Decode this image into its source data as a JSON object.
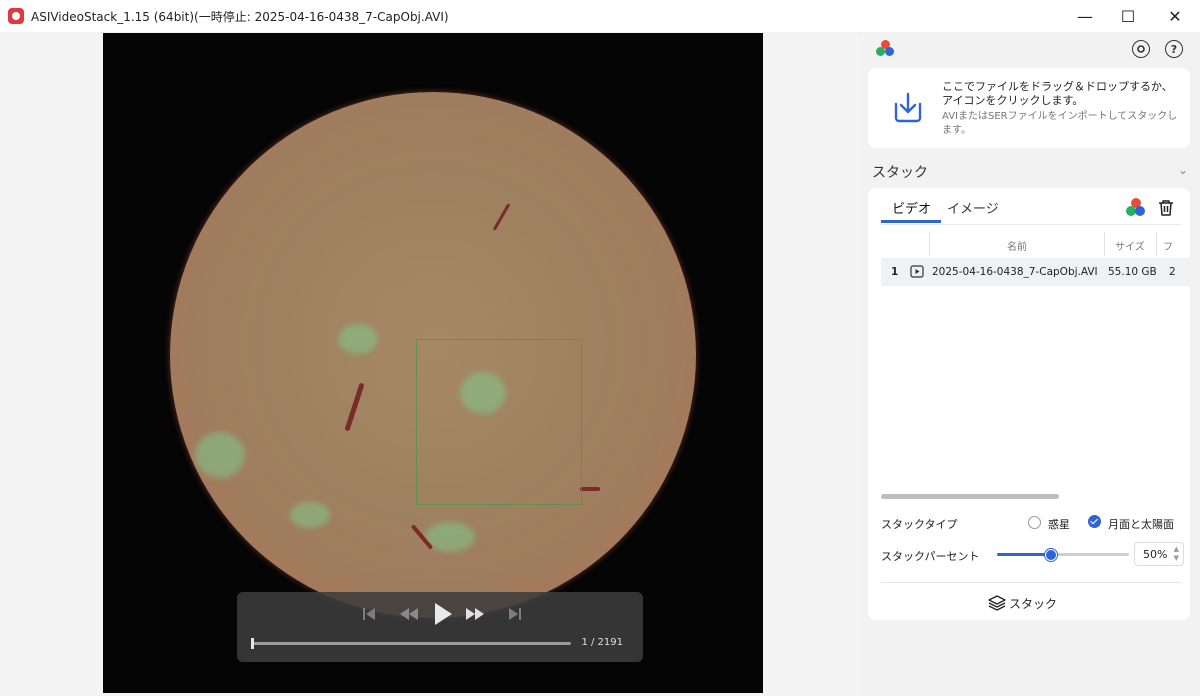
{
  "window": {
    "title": "ASIVideoStack_1.15 (64bit)(一時停止: 2025-04-16-0438_7-CapObj.AVI)",
    "controls": {
      "minimize": "—",
      "maximize": "☐",
      "close": "✕"
    }
  },
  "player": {
    "frame_counter": "1 / 2191",
    "progress": 0.0,
    "icons": [
      "skip-back-icon",
      "rewind-icon",
      "play-icon",
      "fast-forward-icon",
      "skip-forward-icon"
    ]
  },
  "panel": {
    "import": {
      "main_text": "ここでファイルをドラッグ＆ドロップするか、アイコンをクリックします。",
      "sub_text": "AVIまたはSERファイルをインポートしてスタックします。"
    },
    "stack_section": {
      "title": "スタック",
      "tabs": [
        {
          "label": "ビデオ",
          "active": true
        },
        {
          "label": "イメージ",
          "active": false
        }
      ],
      "columns": [
        "名前",
        "サイズ",
        "フ"
      ],
      "rows": [
        {
          "index": "1",
          "name": "2025-04-16-0438_7-CapObj.AVI",
          "size": "55.10 GB",
          "extra": "2"
        }
      ],
      "stack_type_label": "スタックタイプ",
      "stack_type_options": [
        {
          "label": "惑星",
          "selected": false
        },
        {
          "label": "月面と太陽面",
          "selected": true
        }
      ],
      "stack_percent_label": "スタックパーセント",
      "stack_percent_value": "50%",
      "stack_percent_fraction": 0.4,
      "stack_button_label": "スタック"
    }
  },
  "colors": {
    "accent": "#2f64d6",
    "sun_disk": "#a5825f",
    "sun_limb": "#d46a5b"
  }
}
